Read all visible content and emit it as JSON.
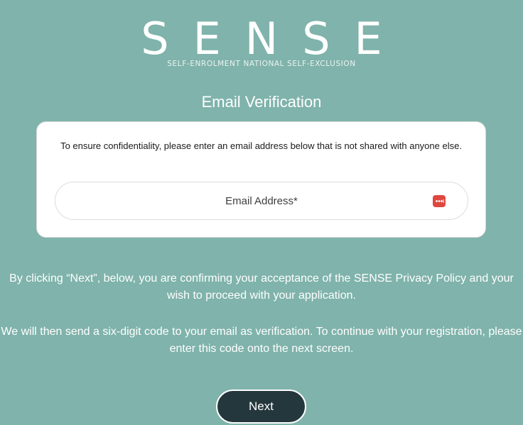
{
  "brand": {
    "logo_text": "SENSE",
    "tagline": "SELF-ENROLMENT NATIONAL SELF-EXCLUSION"
  },
  "page": {
    "heading": "Email Verification"
  },
  "card": {
    "instruction": "To ensure confidentiality, please enter an email address below that is not shared with anyone else.",
    "email_placeholder": "Email Address*",
    "email_value": "",
    "password_manager_icon": "password-manager-icon"
  },
  "info": {
    "paragraph_1": "By clicking “Next”, below, you are confirming your acceptance of the SENSE Privacy Policy and your wish to proceed with your application.",
    "paragraph_2": "We will then send a six-digit code to your email as verification. To continue with your registration, please enter this code onto the next screen."
  },
  "actions": {
    "next_label": "Next"
  },
  "colors": {
    "background": "#7fb3ab",
    "button": "#24373d",
    "icon": "#e0473f"
  }
}
